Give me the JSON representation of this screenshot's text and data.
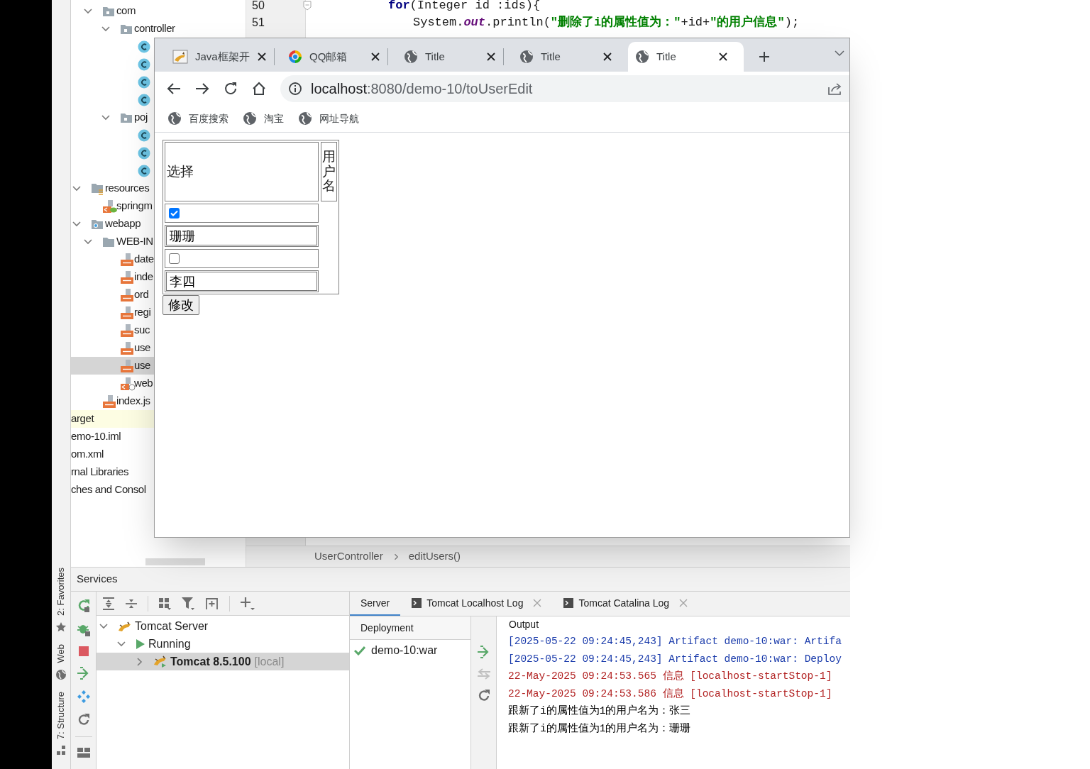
{
  "tool_strip": [
    {
      "label": "2: Favorites",
      "kind": "favorites"
    },
    {
      "label": "Web",
      "kind": "web"
    },
    {
      "label": "7: Structure",
      "kind": "structure"
    }
  ],
  "project_tree": [
    {
      "children": [
        {
          "children": [
            {
              "label": "com",
              "kind": "package",
              "expanded": true,
              "selected": false,
              "excluded": false,
              "children": [
                {
                  "label": "controller",
                  "kind": "package",
                  "expanded": true,
                  "selected": false,
                  "excluded": false,
                  "children": [
                    {
                      "kind": "class",
                      "selected": false,
                      "excluded": false
                    },
                    {
                      "kind": "class",
                      "selected": false,
                      "excluded": false
                    },
                    {
                      "kind": "class",
                      "selected": false,
                      "excluded": false
                    },
                    {
                      "kind": "class",
                      "selected": false,
                      "excluded": false
                    }
                  ]
                },
                {
                  "label": "poj",
                  "kind": "package",
                  "expanded": true,
                  "selected": false,
                  "excluded": false,
                  "children": [
                    {
                      "kind": "class",
                      "selected": false,
                      "excluded": false
                    },
                    {
                      "kind": "class",
                      "selected": false,
                      "excluded": false
                    },
                    {
                      "kind": "class",
                      "selected": false,
                      "excluded": false
                    }
                  ]
                }
              ]
            }
          ]
        },
        {
          "label": "resources",
          "kind": "resources",
          "expanded": true,
          "selected": false,
          "excluded": false,
          "children": [
            {
              "label": "springm",
              "kind": "spring",
              "selected": false,
              "excluded": false
            }
          ]
        },
        {
          "label": "webapp",
          "kind": "webapp",
          "expanded": true,
          "selected": false,
          "excluded": false,
          "children": [
            {
              "label": "WEB-IN",
              "kind": "folder",
              "expanded": true,
              "selected": false,
              "excluded": false,
              "children": [
                {
                  "label": "date",
                  "kind": "jsp",
                  "selected": false,
                  "excluded": false
                },
                {
                  "label": "inde",
                  "kind": "jsp",
                  "selected": false,
                  "excluded": false
                },
                {
                  "label": "ord",
                  "kind": "jsp",
                  "selected": false,
                  "excluded": false
                },
                {
                  "label": "regi",
                  "kind": "jsp",
                  "selected": false,
                  "excluded": false
                },
                {
                  "label": "suc",
                  "kind": "jsp",
                  "selected": false,
                  "excluded": false
                },
                {
                  "label": "use",
                  "kind": "jsp",
                  "selected": false,
                  "excluded": false
                },
                {
                  "label": "use",
                  "kind": "jsp",
                  "selected": true,
                  "excluded": false
                },
                {
                  "label": "web",
                  "kind": "webxml",
                  "selected": false,
                  "excluded": false
                }
              ]
            },
            {
              "label": "index.js",
              "kind": "jsp",
              "selected": false,
              "excluded": false
            }
          ]
        }
      ]
    },
    {
      "label": "arget",
      "selected": false,
      "excluded": true
    },
    {
      "label": "emo-10.iml",
      "selected": false,
      "excluded": false
    },
    {
      "label": "om.xml",
      "selected": false,
      "excluded": false
    },
    {
      "label": "rnal Libraries",
      "selected": false,
      "excluded": false
    },
    {
      "label": "ches and Consol",
      "selected": false,
      "excluded": false
    }
  ],
  "editor": {
    "lines": [
      {
        "number": "50",
        "segments": [
          {
            "text": "for",
            "kind": "keyword"
          },
          {
            "text": "(Integer id :ids){",
            "kind": "plain"
          }
        ],
        "children": [
          {
            "number": "51",
            "segments": [
              {
                "text": "System.",
                "kind": "plain"
              },
              {
                "text": "out",
                "kind": "field"
              },
              {
                "text": ".println(",
                "kind": "plain"
              },
              {
                "text": "\"删除了i的属性值为：\"",
                "kind": "string"
              },
              {
                "text": "+id+",
                "kind": "plain"
              },
              {
                "text": "\"的用户信息\"",
                "kind": "string"
              },
              {
                "text": ");",
                "kind": "plain"
              }
            ]
          }
        ]
      }
    ],
    "breadcrumb": [
      "UserController",
      "editUsers()"
    ]
  },
  "browser": {
    "tabs": [
      {
        "title": "Java框架开",
        "kind": "image",
        "selected": false
      },
      {
        "title": "QQ邮箱",
        "kind": "mail",
        "selected": false
      },
      {
        "title": "Title",
        "kind": "page",
        "selected": false
      },
      {
        "title": "Title",
        "kind": "page",
        "selected": false
      },
      {
        "title": "Title",
        "kind": "page",
        "selected": true
      }
    ],
    "address": {
      "host": "localhost",
      "rest": ":8080/demo-10/toUserEdit"
    },
    "bookmarks": [
      "百度搜索",
      "淘宝",
      "网址导航"
    ],
    "page": {
      "headers": [
        "选择",
        "用户名"
      ],
      "rows": [
        {
          "kind": "checkbox",
          "checked": true
        },
        {
          "kind": "text",
          "value": "珊珊"
        },
        {
          "kind": "checkbox",
          "checked": false
        },
        {
          "kind": "text",
          "value": "李四"
        }
      ],
      "submit": "修改"
    }
  },
  "services": {
    "title": "Services",
    "tree": [
      {
        "label": "Tomcat Server",
        "kind": "server",
        "expanded": true,
        "selected": false,
        "children": [
          {
            "label": "Running",
            "kind": "status",
            "expanded": true,
            "selected": false,
            "children": [
              {
                "label": "Tomcat 8.5.100",
                "suffix": "[local]",
                "kind": "instance",
                "expanded": false,
                "selected": true
              }
            ]
          }
        ]
      }
    ],
    "tabs": [
      {
        "label": "Server",
        "kind": "server",
        "selected": true
      },
      {
        "label": "Tomcat Localhost Log",
        "kind": "log",
        "selected": false
      },
      {
        "label": "Tomcat Catalina Log",
        "kind": "log",
        "selected": false
      }
    ],
    "deployment": {
      "header": "Deployment",
      "items": [
        "demo-10:war"
      ]
    },
    "output": {
      "header": "Output",
      "lines": [
        {
          "text": "[2025-05-22 09:24:45,243] Artifact demo-10:war: Artifa",
          "kind": "system"
        },
        {
          "text": "[2025-05-22 09:24:45,243] Artifact demo-10:war: Deploy",
          "kind": "system"
        },
        {
          "text": "22-May-2025 09:24:53.565 信息 [localhost-startStop-1]",
          "kind": "log"
        },
        {
          "text": "22-May-2025 09:24:53.586 信息 [localhost-startStop-1]",
          "kind": "log"
        },
        {
          "text": "跟新了i的属性值为1的用户名为：张三",
          "kind": "stdout"
        },
        {
          "text": "跟新了i的属性值为1的用户名为：珊珊",
          "kind": "stdout"
        }
      ]
    }
  }
}
